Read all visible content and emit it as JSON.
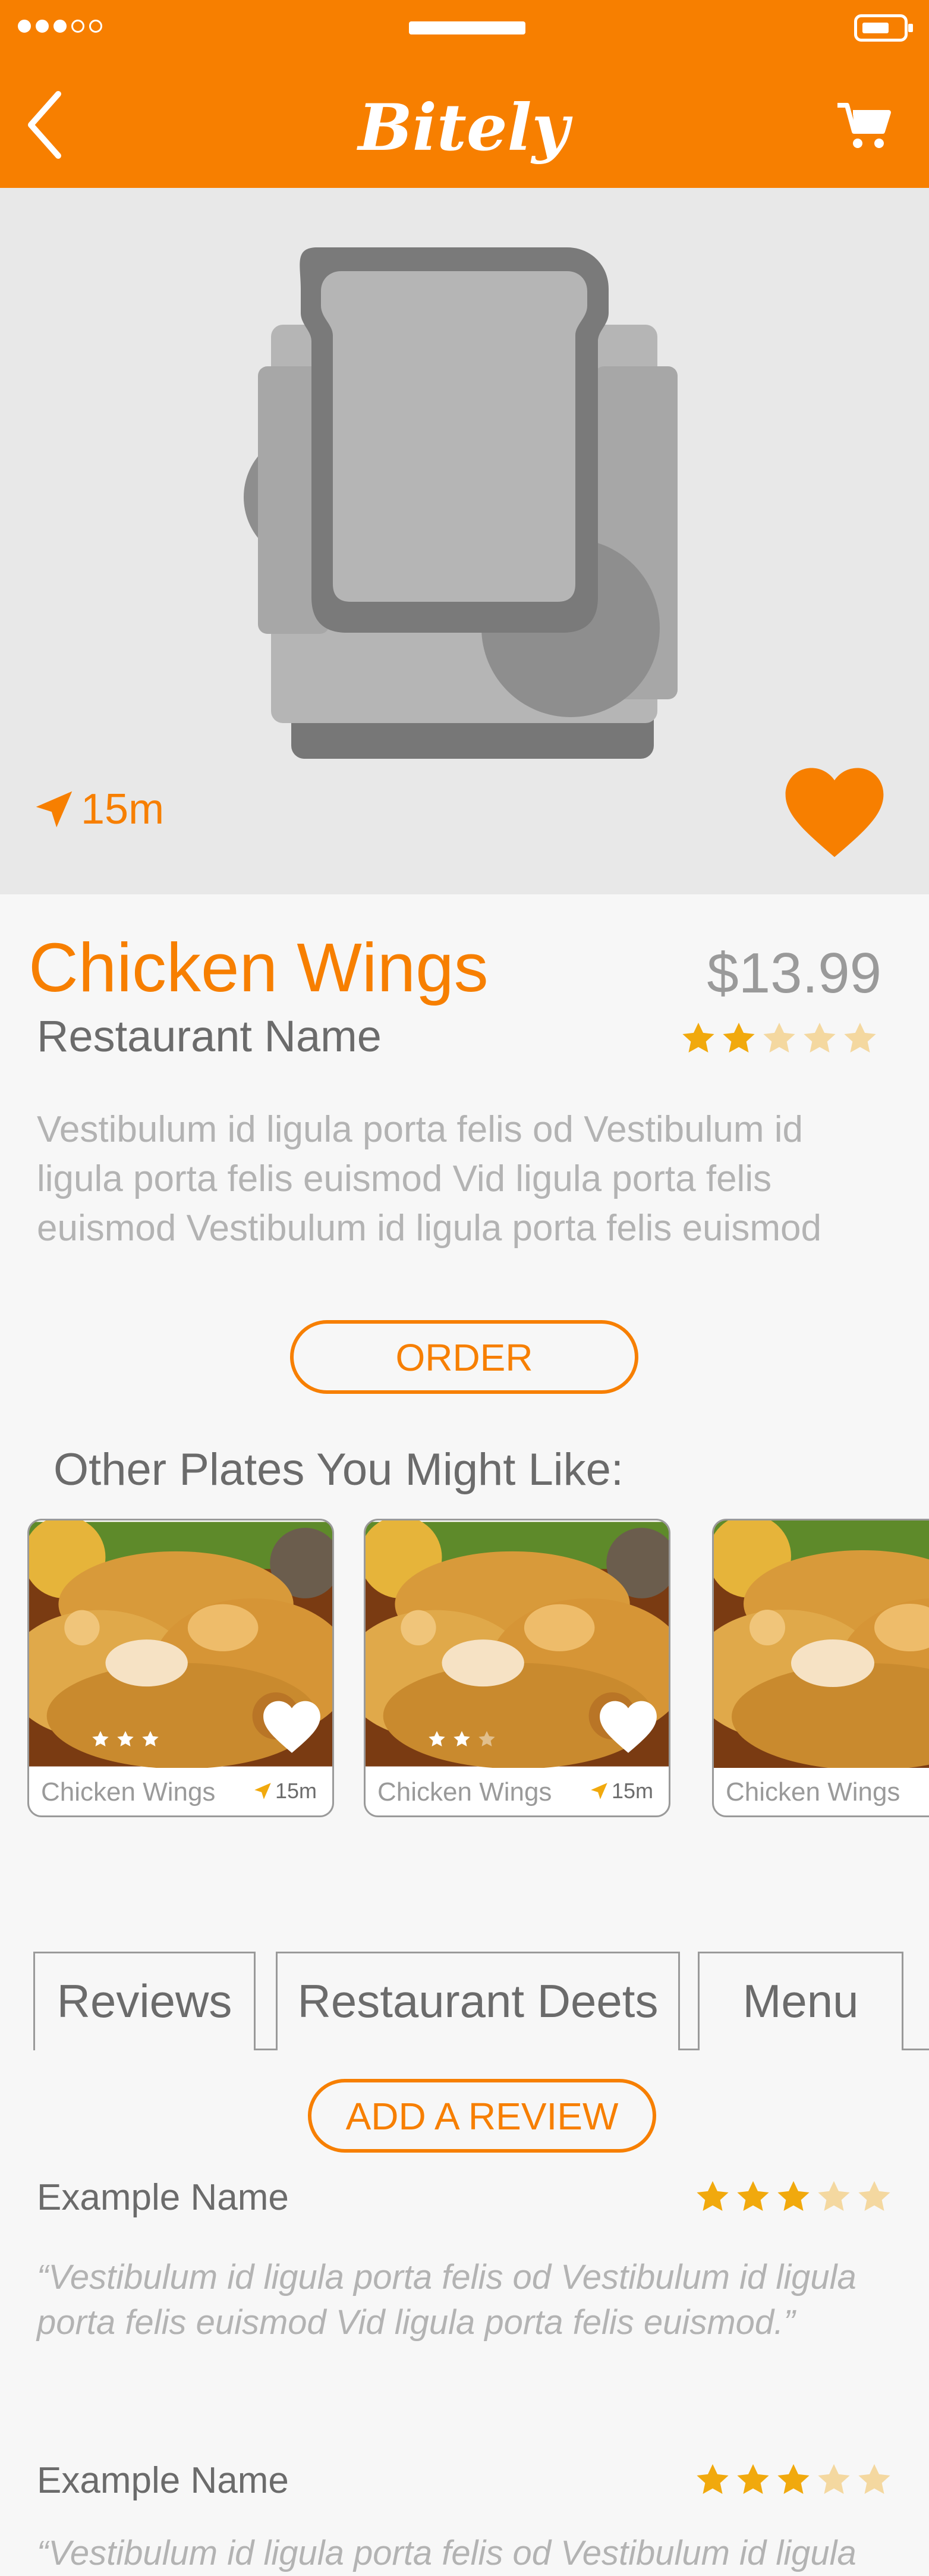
{
  "app": {
    "title": "Bitely"
  },
  "colors": {
    "brand": "#f77f00",
    "star": "#f1a90d",
    "star_empty": "#f4d8a0"
  },
  "icons": {
    "back": "chevron-left-icon",
    "cart": "cart-icon",
    "location": "navigation-arrow-icon",
    "favorite": "heart-icon",
    "star": "star-icon"
  },
  "hero": {
    "distance": "15m"
  },
  "dish": {
    "name": "Chicken Wings",
    "price": "$13.99",
    "restaurant": "Restaurant Name",
    "rating": 2,
    "max_rating": 5,
    "description": "Vestibulum id ligula porta felis od Vestibulum id ligula porta felis euismod Vid ligula porta felis euismod Vestibulum id ligula porta felis euismod"
  },
  "order_label": "ORDER",
  "others": {
    "title": "Other Plates You Might Like:",
    "items": [
      {
        "name": "Chicken Wings",
        "distance": "15m",
        "rating": 3
      },
      {
        "name": "Chicken Wings",
        "distance": "15m",
        "rating": 2
      },
      {
        "name": "Chicken Wings"
      }
    ]
  },
  "tabs": [
    "Reviews",
    "Restaurant Deets",
    "Menu"
  ],
  "add_review_label": "ADD A REVIEW",
  "reviews": [
    {
      "name": "Example Name",
      "rating": 3,
      "text": "“Vestibulum id ligula porta felis od Vestibulum id ligula porta felis euismod Vid ligula porta felis euismod.”"
    },
    {
      "name": "Example Name",
      "rating": 3,
      "text": "“Vestibulum id ligula porta felis od Vestibulum id ligula"
    }
  ]
}
